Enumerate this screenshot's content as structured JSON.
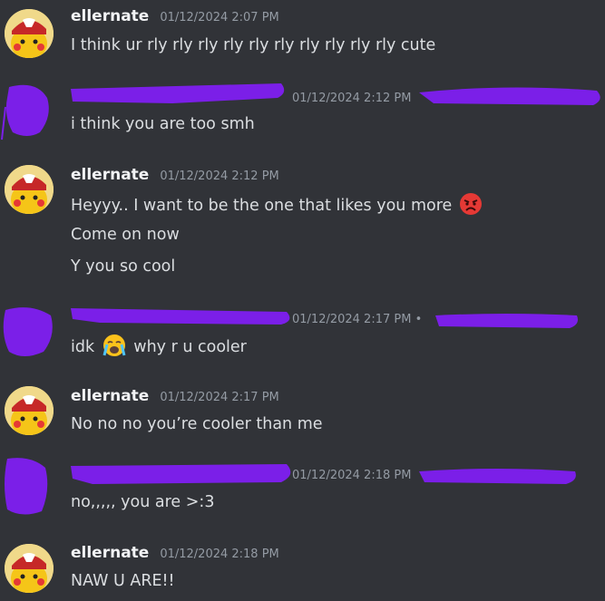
{
  "messages": [
    {
      "user": "ellernate",
      "time": "01/12/2024 2:07 PM",
      "lines": [
        "I think ur rly rly rly rly rly rly rly rly rly rly cute"
      ]
    },
    {
      "user": "",
      "time": "01/12/2024 2:12 PM",
      "lines": [
        "i think you are too smh"
      ]
    },
    {
      "user": "ellernate",
      "time": "01/12/2024 2:12 PM",
      "lines": [
        "Heyyy.. I want to be the one that likes you more",
        "Come on now",
        "Y you so cool"
      ]
    },
    {
      "user": "",
      "time": "01/12/2024 2:17 PM •",
      "lines_a": "idk",
      "lines_b": "why r u cooler"
    },
    {
      "user": "ellernate",
      "time": "01/12/2024 2:17 PM",
      "lines": [
        "No no no you’re cooler than me"
      ]
    },
    {
      "user": "",
      "time": "01/12/2024 2:18 PM",
      "lines": [
        "no,,,,, you are >:3"
      ]
    },
    {
      "user": "ellernate",
      "time": "01/12/2024 2:18 PM",
      "lines": [
        "NAW U ARE!!"
      ]
    }
  ],
  "icons": {
    "angry": "angry-face-icon",
    "cry": "loudly-crying-face-icon"
  },
  "colors": {
    "background": "#313338",
    "redaction": "#7b1fe8",
    "username": "#f2f3f5",
    "timestamp": "#949ba4"
  }
}
